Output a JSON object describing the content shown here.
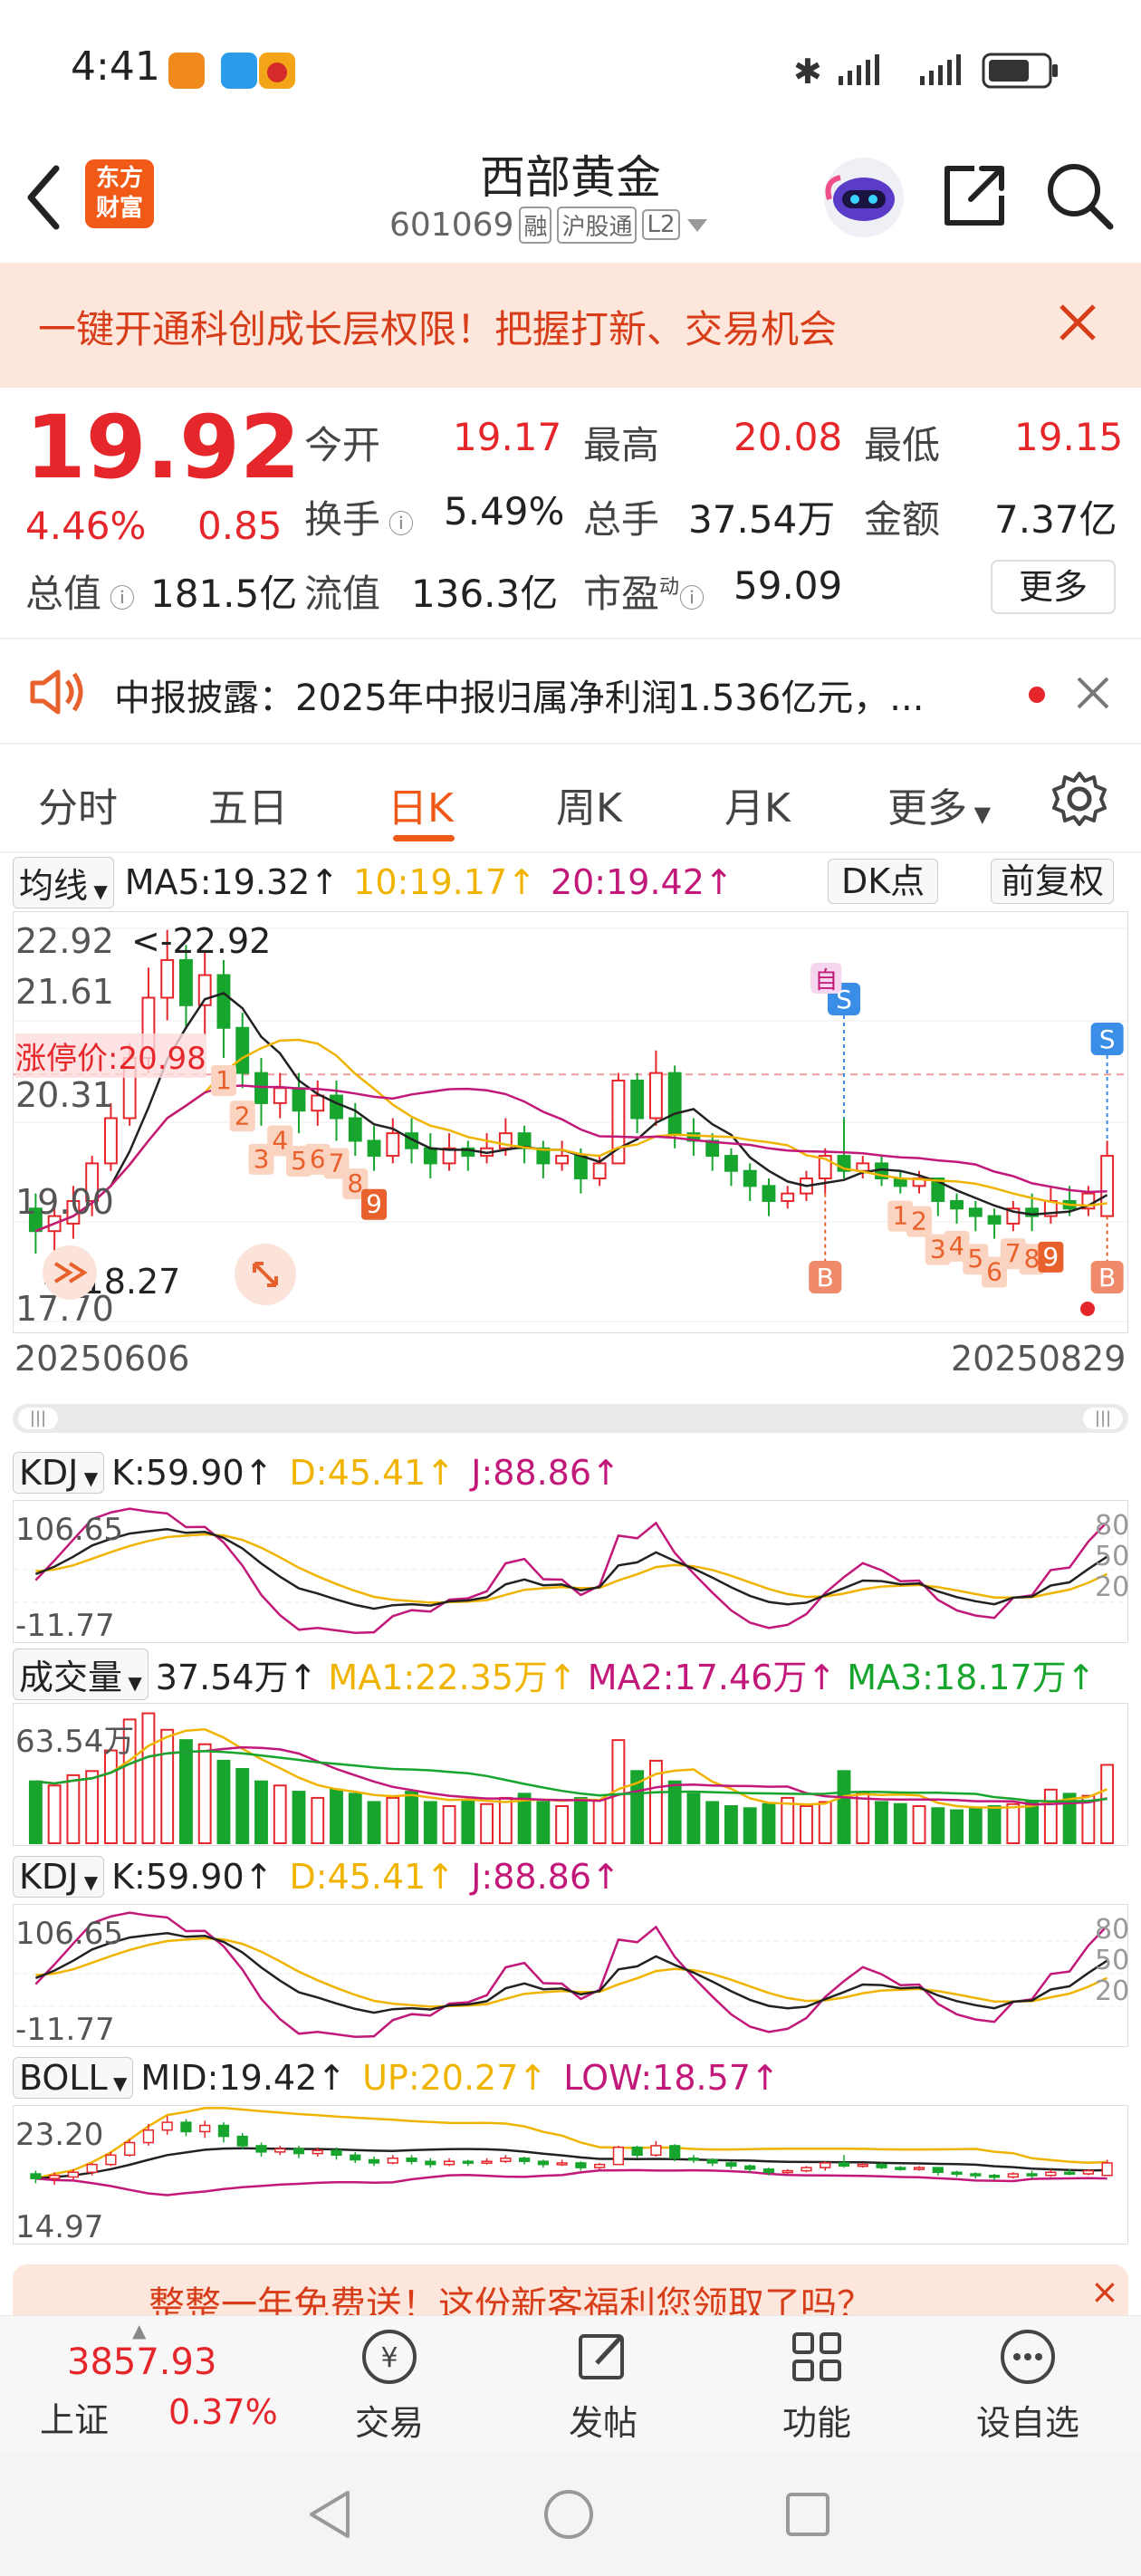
{
  "status": {
    "time": "4:41"
  },
  "header": {
    "logo_line1": "东方",
    "logo_line2": "财富",
    "title": "西部黄金",
    "code": "601069",
    "badge_margin": "融",
    "badge_connect": "沪股通",
    "badge_level": "L2"
  },
  "banner": {
    "text": "一键开通科创成长层权限！把握打新、交易机会"
  },
  "quote": {
    "price": "19.92",
    "change_pct": "4.46%",
    "change": "0.85",
    "open_label": "今开",
    "open": "19.17",
    "high_label": "最高",
    "high": "20.08",
    "low_label": "最低",
    "low": "19.15",
    "turnover_label": "换手",
    "turnover": "5.49%",
    "volume_label": "总手",
    "volume": "37.54万",
    "amount_label": "金额",
    "amount": "7.37亿",
    "mktcap_label": "总值",
    "mktcap": "181.5亿",
    "float_label": "流值",
    "float": "136.3亿",
    "pe_label": "市盈",
    "pe_sup": "动",
    "pe": "59.09",
    "more_button": "更多"
  },
  "news": {
    "text": "中报披露：2025年中报归属净利润1.536亿元，..."
  },
  "tabs": [
    "分时",
    "五日",
    "日K",
    "周K",
    "月K",
    "更多"
  ],
  "active_tab": 2,
  "kline": {
    "indicator": "均线",
    "ma5": "MA5:19.32↑",
    "ma10": "10:19.17↑",
    "ma20": "20:19.42↑",
    "dk_button": "DK点",
    "adjust_button": "前复权",
    "y_top": "22.92",
    "y_2": "21.61",
    "y_3": "20.31",
    "y_4": "19.00",
    "y_bottom": "17.70",
    "max_label": "<-22.92",
    "min_label": "<-18.27",
    "limit_label": "涨停价:20.98",
    "date_start": "20250606",
    "date_end": "20250829",
    "tag_zi": "自",
    "tag_s": "S",
    "tag_b": "B",
    "seq_a": [
      "1",
      "2",
      "3",
      "4",
      "5",
      "6",
      "7",
      "8",
      "9"
    ],
    "seq_b": [
      "1",
      "2",
      "3",
      "4",
      "5",
      "6",
      "7",
      "8",
      "9"
    ],
    "colors": {
      "up": "#e5262b",
      "down": "#17a52e",
      "ma5": "#222222",
      "ma10": "#f0b400",
      "ma20": "#c2187a"
    }
  },
  "kdj1": {
    "name": "KDJ",
    "k": "K:59.90↑",
    "d": "D:45.41↑",
    "j": "J:88.86↑",
    "y_top": "106.65",
    "y_bottom": "-11.77",
    "r80": "80",
    "r50": "50",
    "r20": "20"
  },
  "volume": {
    "name": "成交量",
    "value": "37.54万↑",
    "ma1": "MA1:22.35万↑",
    "ma2": "MA2:17.46万↑",
    "ma3": "MA3:18.17万↑",
    "y_top": "63.54万"
  },
  "kdj2": {
    "name": "KDJ",
    "k": "K:59.90↑",
    "d": "D:45.41↑",
    "j": "J:88.86↑",
    "y_top": "106.65",
    "y_bottom": "-11.77",
    "r80": "80",
    "r50": "50",
    "r20": "20"
  },
  "boll": {
    "name": "BOLL",
    "mid": "MID:19.42↑",
    "up": "UP:20.27↑",
    "low": "LOW:18.57↑",
    "y_top": "23.20",
    "y_bottom": "14.97"
  },
  "promo": {
    "text": "整整一年免费送！这份新客福利您领取了吗？"
  },
  "bottom": {
    "index_value": "3857.93",
    "index_name": "上证",
    "index_pct": "0.37%",
    "trade": "交易",
    "post": "发帖",
    "func": "功能",
    "watch": "设自选"
  },
  "chart_data": {
    "type": "candlestick",
    "candles": [
      [
        19.2,
        18.9,
        19.4,
        18.6
      ],
      [
        18.9,
        19.1,
        19.3,
        18.5
      ],
      [
        19.0,
        19.3,
        19.5,
        18.8
      ],
      [
        19.3,
        19.8,
        19.9,
        19.1
      ],
      [
        19.8,
        20.4,
        20.6,
        19.7
      ],
      [
        20.4,
        21.2,
        21.4,
        20.3
      ],
      [
        21.2,
        22.0,
        22.4,
        21.0
      ],
      [
        22.0,
        22.5,
        22.9,
        21.7
      ],
      [
        22.5,
        21.9,
        22.7,
        21.6
      ],
      [
        21.9,
        22.3,
        22.6,
        21.5
      ],
      [
        22.3,
        21.6,
        22.5,
        21.2
      ],
      [
        21.6,
        21.0,
        21.8,
        20.8
      ],
      [
        21.0,
        20.6,
        21.2,
        20.3
      ],
      [
        20.6,
        20.8,
        21.0,
        20.4
      ],
      [
        20.8,
        20.5,
        21.0,
        20.2
      ],
      [
        20.5,
        20.7,
        20.9,
        20.3
      ],
      [
        20.7,
        20.4,
        20.9,
        20.1
      ],
      [
        20.4,
        20.1,
        20.6,
        19.9
      ],
      [
        20.1,
        19.9,
        20.3,
        19.7
      ],
      [
        19.9,
        20.2,
        20.4,
        19.8
      ],
      [
        20.2,
        20.0,
        20.4,
        19.8
      ],
      [
        20.0,
        19.8,
        20.2,
        19.6
      ],
      [
        19.8,
        20.0,
        20.2,
        19.7
      ],
      [
        20.0,
        19.9,
        20.1,
        19.7
      ],
      [
        19.9,
        20.0,
        20.2,
        19.8
      ],
      [
        20.0,
        20.2,
        20.4,
        19.9
      ],
      [
        20.2,
        20.0,
        20.3,
        19.8
      ],
      [
        20.0,
        19.8,
        20.1,
        19.6
      ],
      [
        19.8,
        19.9,
        20.1,
        19.7
      ],
      [
        19.9,
        19.6,
        20.0,
        19.4
      ],
      [
        19.6,
        19.8,
        19.9,
        19.5
      ],
      [
        19.8,
        20.9,
        21.0,
        19.8
      ],
      [
        20.9,
        20.4,
        21.0,
        20.2
      ],
      [
        20.4,
        21.0,
        21.3,
        20.3
      ],
      [
        21.0,
        20.2,
        21.1,
        20.0
      ],
      [
        20.2,
        20.1,
        20.4,
        19.9
      ],
      [
        20.1,
        19.9,
        20.2,
        19.7
      ],
      [
        19.9,
        19.7,
        20.0,
        19.5
      ],
      [
        19.7,
        19.5,
        19.8,
        19.3
      ],
      [
        19.5,
        19.3,
        19.6,
        19.1
      ],
      [
        19.3,
        19.4,
        19.5,
        19.2
      ],
      [
        19.4,
        19.6,
        19.7,
        19.3
      ],
      [
        19.6,
        19.9,
        20.0,
        19.4
      ],
      [
        19.9,
        19.7,
        20.4,
        19.6
      ],
      [
        19.7,
        19.8,
        19.9,
        19.6
      ],
      [
        19.8,
        19.6,
        19.9,
        19.5
      ],
      [
        19.6,
        19.5,
        19.7,
        19.4
      ],
      [
        19.5,
        19.6,
        19.7,
        19.4
      ],
      [
        19.6,
        19.3,
        19.6,
        19.1
      ],
      [
        19.3,
        19.2,
        19.4,
        19.0
      ],
      [
        19.2,
        19.1,
        19.3,
        18.9
      ],
      [
        19.1,
        19.0,
        19.2,
        18.8
      ],
      [
        19.0,
        19.2,
        19.3,
        18.9
      ],
      [
        19.2,
        19.1,
        19.4,
        18.9
      ],
      [
        19.1,
        19.3,
        19.5,
        19.0
      ],
      [
        19.3,
        19.2,
        19.5,
        19.1
      ],
      [
        19.2,
        19.4,
        19.5,
        19.1
      ],
      [
        19.1,
        19.9,
        20.1,
        19.1
      ]
    ],
    "volumes": [
      30,
      28,
      33,
      35,
      45,
      60,
      63,
      55,
      50,
      48,
      40,
      36,
      30,
      28,
      25,
      22,
      26,
      24,
      20,
      22,
      25,
      20,
      18,
      21,
      19,
      22,
      24,
      20,
      18,
      22,
      21,
      50,
      35,
      40,
      30,
      24,
      20,
      18,
      17,
      19,
      22,
      18,
      20,
      35,
      24,
      20,
      19,
      18,
      17,
      16,
      17,
      18,
      19,
      20,
      26,
      24,
      23,
      38
    ]
  }
}
